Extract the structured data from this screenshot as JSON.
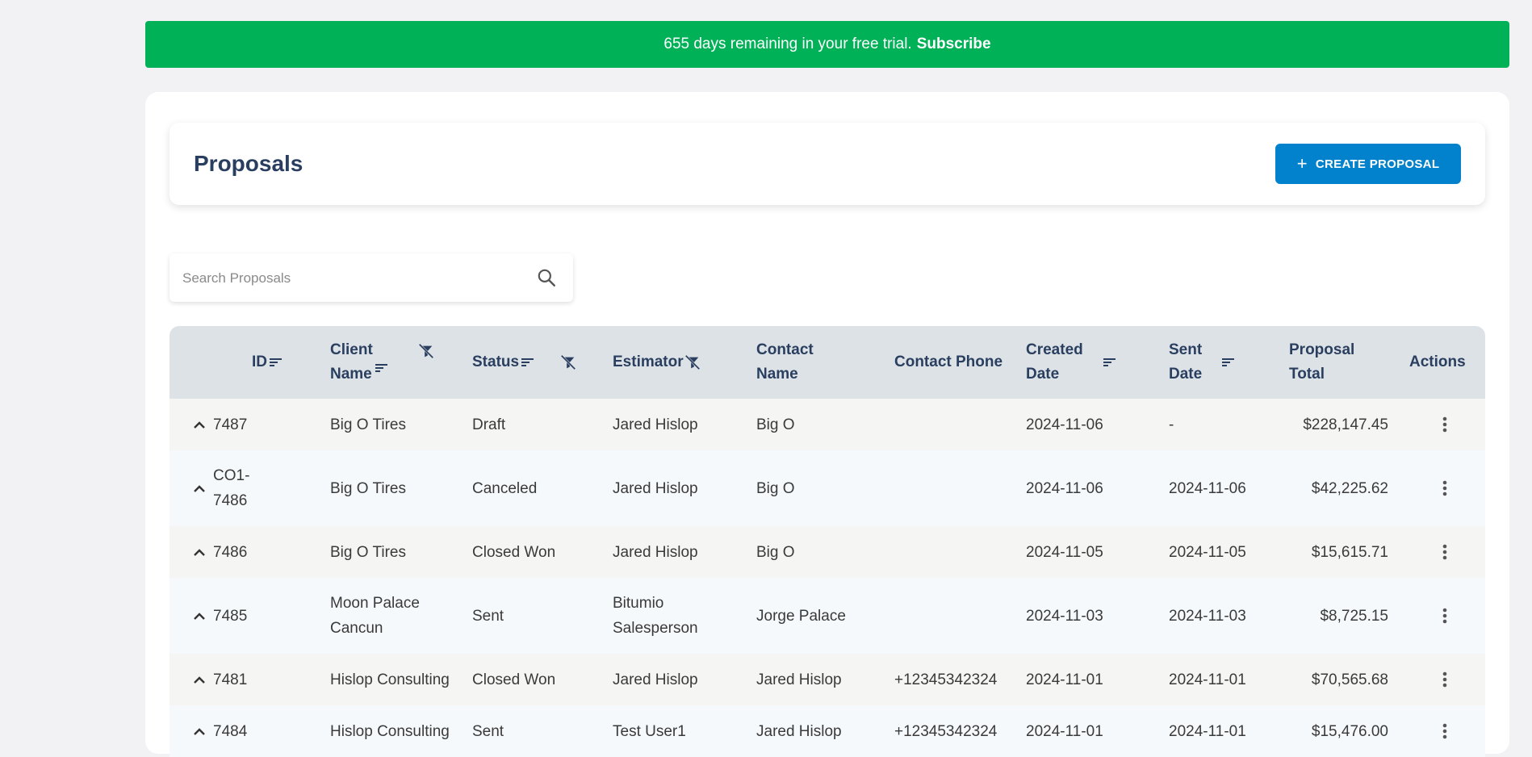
{
  "banner": {
    "text": "655 days remaining in your free trial.",
    "link": "Subscribe"
  },
  "page": {
    "title": "Proposals",
    "create_button": "CREATE PROPOSAL"
  },
  "search": {
    "placeholder": "Search Proposals",
    "value": ""
  },
  "table": {
    "columns": {
      "id": "ID",
      "client_name_1": "Client",
      "client_name_2": "Name",
      "status": "Status",
      "estimator": "Estimator",
      "contact_name_1": "Contact",
      "contact_name_2": "Name",
      "contact_phone": "Contact Phone",
      "created_date_1": "Created",
      "created_date_2": "Date",
      "sent_date_1": "Sent",
      "sent_date_2": "Date",
      "proposal_total_1": "Proposal",
      "proposal_total_2": "Total",
      "actions": "Actions"
    },
    "rows": [
      {
        "id_1": "7487",
        "id_2": "",
        "client_1": "Big O Tires",
        "client_2": "",
        "status": "Draft",
        "estimator_1": "Jared Hislop",
        "estimator_2": "",
        "contact": "Big O",
        "phone": "",
        "created": "2024-11-06",
        "sent": "-",
        "total": "$228,147.45"
      },
      {
        "id_1": "CO1-",
        "id_2": "7486",
        "client_1": "Big O Tires",
        "client_2": "",
        "status": "Canceled",
        "estimator_1": "Jared Hislop",
        "estimator_2": "",
        "contact": "Big O",
        "phone": "",
        "created": "2024-11-06",
        "sent": "2024-11-06",
        "total": "$42,225.62"
      },
      {
        "id_1": "7486",
        "id_2": "",
        "client_1": "Big O Tires",
        "client_2": "",
        "status": "Closed Won",
        "estimator_1": "Jared Hislop",
        "estimator_2": "",
        "contact": "Big O",
        "phone": "",
        "created": "2024-11-05",
        "sent": "2024-11-05",
        "total": "$15,615.71"
      },
      {
        "id_1": "7485",
        "id_2": "",
        "client_1": "Moon Palace",
        "client_2": "Cancun",
        "status": "Sent",
        "estimator_1": "Bitumio",
        "estimator_2": "Salesperson",
        "contact": "Jorge Palace",
        "phone": "",
        "created": "2024-11-03",
        "sent": "2024-11-03",
        "total": "$8,725.15"
      },
      {
        "id_1": "7481",
        "id_2": "",
        "client_1": "Hislop Consulting",
        "client_2": "",
        "status": "Closed Won",
        "estimator_1": "Jared Hislop",
        "estimator_2": "",
        "contact": "Jared Hislop",
        "phone": "+12345342324",
        "created": "2024-11-01",
        "sent": "2024-11-01",
        "total": "$70,565.68"
      },
      {
        "id_1": "7484",
        "id_2": "",
        "client_1": "Hislop Consulting",
        "client_2": "",
        "status": "Sent",
        "estimator_1": "Test User1",
        "estimator_2": "",
        "contact": "Jared Hislop",
        "phone": "+12345342324",
        "created": "2024-11-01",
        "sent": "2024-11-01",
        "total": "$15,476.00"
      }
    ]
  },
  "colors": {
    "banner": "#00b157",
    "primary": "#0282cc",
    "header_text": "#2a3f5f",
    "table_header_bg": "#dde2e7"
  }
}
